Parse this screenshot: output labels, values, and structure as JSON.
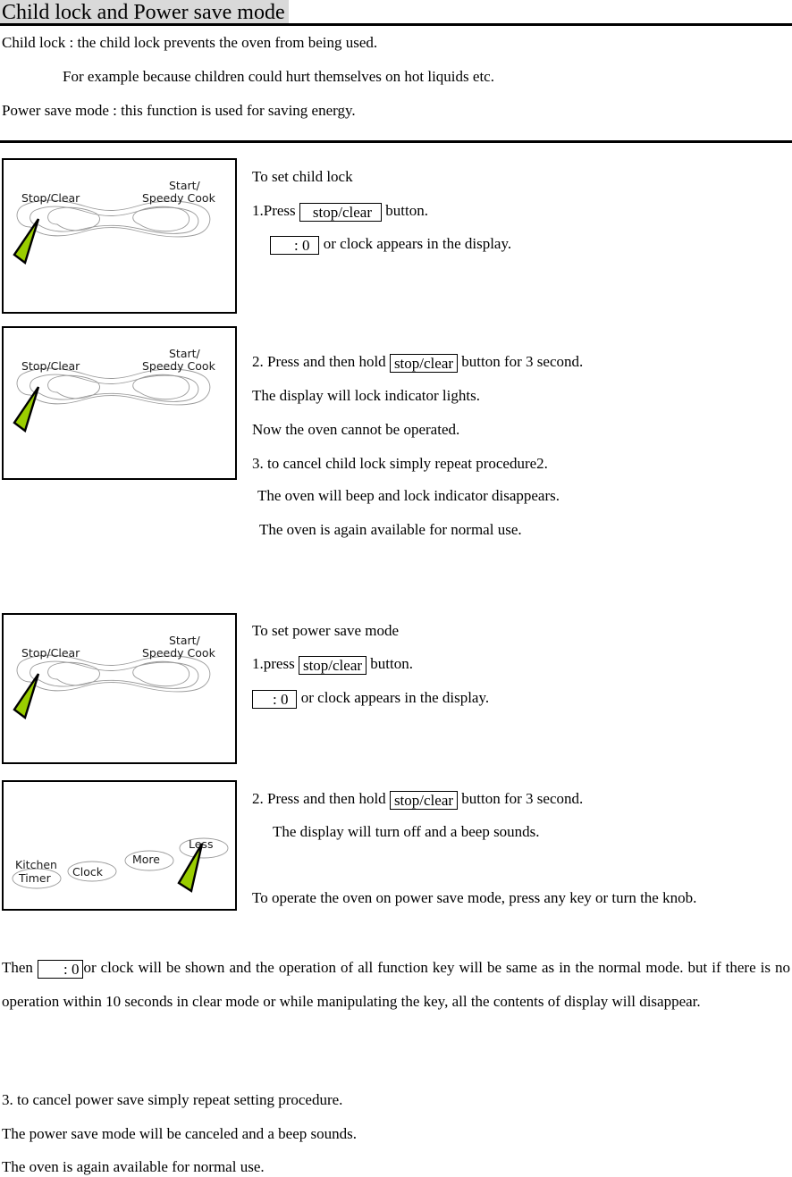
{
  "document": {
    "title": "Child lock and Power save mode",
    "intro": [
      "Child lock : the child lock prevents the oven from being used.",
      "For example because children could hurt themselves on hot liquids etc.",
      "Power save mode : this function is used for saving energy."
    ]
  },
  "diagrams": {
    "control_panel_bone": {
      "labels": {
        "left_button": "Stop/Clear",
        "right_button_line1": "Start/",
        "right_button_line2": "Speedy Cook"
      },
      "pointer_color": "#9ACD00",
      "outline_color": "#808080",
      "pointer_target": "Stop/Clear"
    },
    "control_panel_ovals": {
      "labels": {
        "button_1_line1": "Kitchen",
        "button_1_line2": "Timer",
        "button_2": "Clock",
        "button_3": "More",
        "button_4": "Less"
      },
      "pointer_color": "#9ACD00",
      "outline_color": "#808080",
      "pointer_target": "Less"
    }
  },
  "sections": {
    "child_lock": {
      "heading": "To set child lock",
      "step1_pre": "1.Press",
      "step1_key": "stop/clear",
      "step1_post": "button.",
      "display_value": ": 0",
      "display_post": "or clock appears in the display.",
      "step2_pre": "2. Press and then hold",
      "step2_key": "stop/clear",
      "step2_post": "button for 3 second.",
      "line_lock_indicator": "The display will lock indicator lights.",
      "line_cannot_operate": "Now the oven cannot be operated.",
      "step3": "3. to cancel child lock simply repeat procedure2.",
      "line_beep": "The oven will beep and lock indicator disappears.",
      "line_normal_use": "The oven is again available for normal use."
    },
    "power_save": {
      "heading": "To set power save mode",
      "step1_pre": "1.press",
      "step1_key": "stop/clear",
      "step1_post": "button.",
      "display_value": ": 0",
      "display_post": "or clock appears in the display.",
      "step2_pre": "2. Press and then hold",
      "step2_key": "stop/clear",
      "step2_post": "button for 3 second.",
      "line_display_off": "The display will turn off and a beep sounds.",
      "operate_paragraph": "To operate the oven on power save mode, press any key or turn the knob.",
      "then_pre": "Then",
      "then_display_value": ": 0",
      "then_post": "or clock will be shown and the operation of all function key will be same as in the normal mode. but if there is no operation within 10 seconds in clear mode or while manipulating the key, all the contents of display will disappear.",
      "step3": "3. to cancel power save simply repeat setting procedure.",
      "line_canceled": "The power save mode will be canceled and a beep sounds.",
      "line_normal_use": "The oven is again available for normal use."
    }
  }
}
